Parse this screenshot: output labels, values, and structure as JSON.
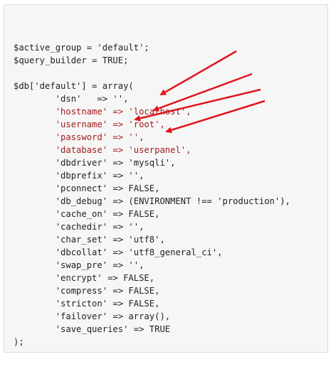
{
  "code": {
    "lines": [
      {
        "text": ""
      },
      {
        "text": "$active_group = 'default';"
      },
      {
        "text": "$query_builder = TRUE;"
      },
      {
        "text": ""
      },
      {
        "text": "$db['default'] = array("
      },
      {
        "text": "        'dsn'   => '',"
      },
      {
        "text": "        'hostname' => 'localhost',",
        "highlight": true
      },
      {
        "text": "        'username' => 'root',",
        "highlight": true
      },
      {
        "text": "        'password' => '',",
        "highlight": true
      },
      {
        "text": "        'database' => 'userpanel',",
        "highlight": true
      },
      {
        "text": "        'dbdriver' => 'mysqli',"
      },
      {
        "text": "        'dbprefix' => '',"
      },
      {
        "text": "        'pconnect' => FALSE,"
      },
      {
        "text": "        'db_debug' => (ENVIRONMENT !== 'production'),"
      },
      {
        "text": "        'cache_on' => FALSE,"
      },
      {
        "text": "        'cachedir' => '',"
      },
      {
        "text": "        'char_set' => 'utf8',"
      },
      {
        "text": "        'dbcollat' => 'utf8_general_ci',"
      },
      {
        "text": "        'swap_pre' => '',"
      },
      {
        "text": "        'encrypt' => FALSE,"
      },
      {
        "text": "        'compress' => FALSE,"
      },
      {
        "text": "        'stricton' => FALSE,"
      },
      {
        "text": "        'failover' => array(),"
      },
      {
        "text": "        'save_queries' => TRUE"
      },
      {
        "text": ");"
      }
    ]
  },
  "annotations": {
    "arrow_color": "#e0141b",
    "arrow_targets": [
      "hostname",
      "username",
      "password",
      "database"
    ]
  }
}
